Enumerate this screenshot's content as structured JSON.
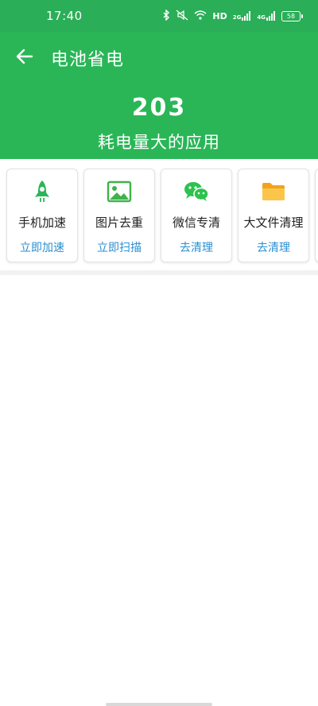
{
  "status": {
    "time": "17:40",
    "net_text": "HD",
    "signal1": "2G",
    "signal2": "4G",
    "battery": "58"
  },
  "header": {
    "title": "电池省电",
    "count": "203",
    "subtitle": "耗电量大的应用"
  },
  "colors": {
    "header_green": "#2ab657",
    "accent_blue": "#2a8fd1"
  },
  "cards": [
    {
      "label": "手机加速",
      "action": "立即加速",
      "icon": "rocket-icon"
    },
    {
      "label": "图片去重",
      "action": "立即扫描",
      "icon": "image-icon"
    },
    {
      "label": "微信专清",
      "action": "去清理",
      "icon": "wechat-icon"
    },
    {
      "label": "大文件清理",
      "action": "去清理",
      "icon": "folder-icon"
    }
  ]
}
